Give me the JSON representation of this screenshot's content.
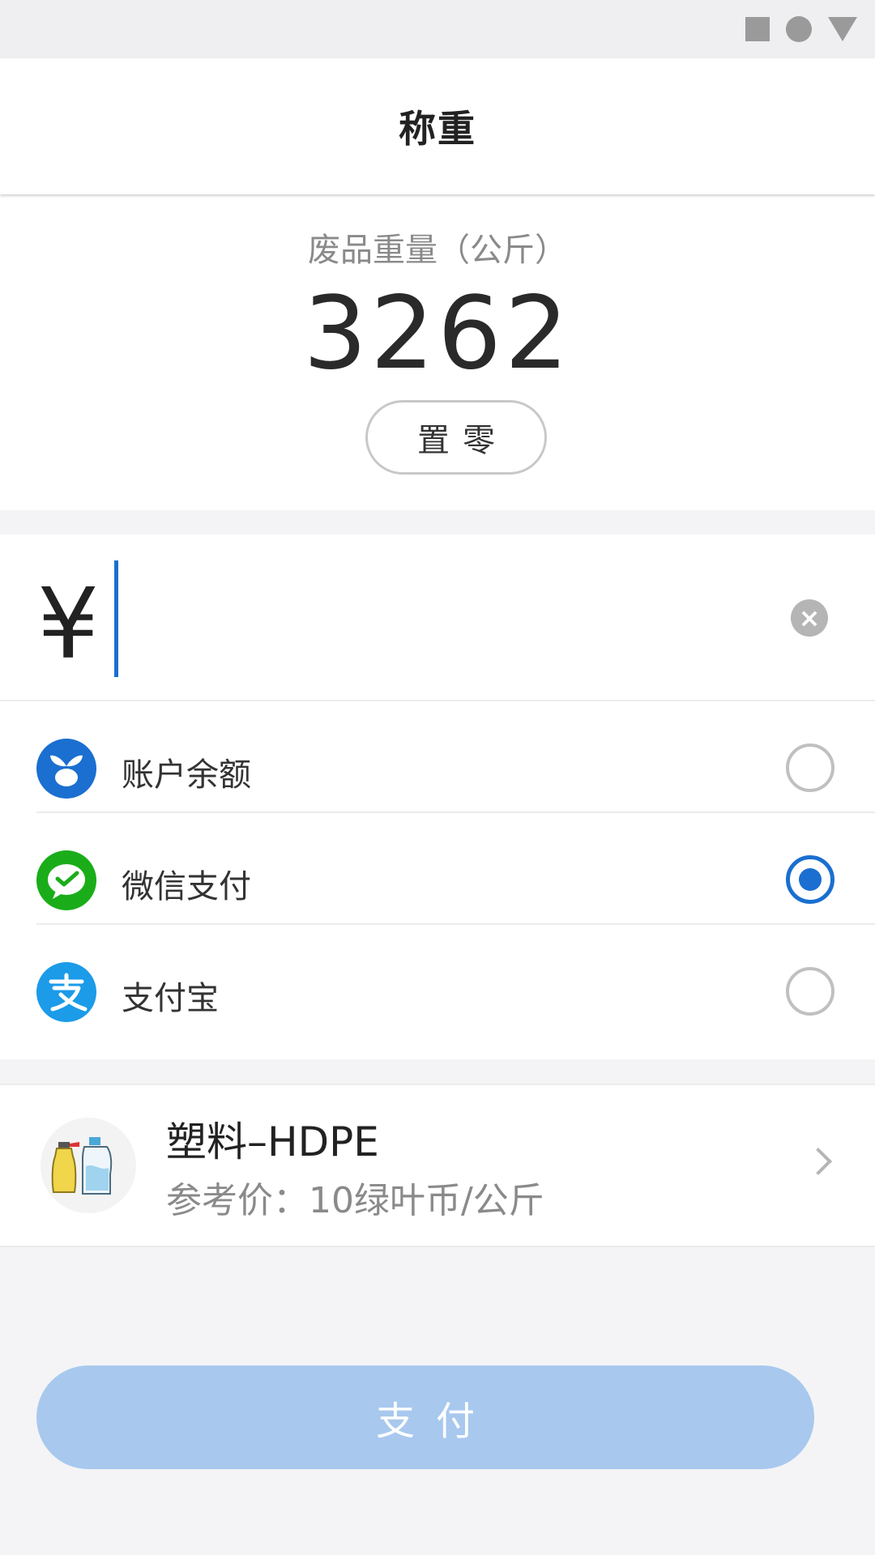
{
  "header": {
    "title": "称重"
  },
  "weight": {
    "label": "废品重量（公斤）",
    "value": "3262",
    "zero_label": "置零"
  },
  "amount": {
    "currency_symbol": "¥",
    "value": ""
  },
  "payments": {
    "selected": "wechat",
    "items": [
      {
        "id": "balance",
        "label": "账户余额",
        "icon": "sprout-icon",
        "color": "#1a6fd0"
      },
      {
        "id": "wechat",
        "label": "微信支付",
        "icon": "wechat-pay-icon",
        "color": "#1aad19"
      },
      {
        "id": "alipay",
        "label": "支付宝",
        "icon": "alipay-icon",
        "color": "#1b9be8"
      }
    ]
  },
  "product": {
    "name": "塑料–HDPE",
    "price": "参考价：10绿叶币/公斤"
  },
  "pay_button": {
    "label": "支付"
  },
  "colors": {
    "accent": "#1a6fd0",
    "pay_button_disabled": "#a8c8ee",
    "background": "#f4f4f6"
  }
}
